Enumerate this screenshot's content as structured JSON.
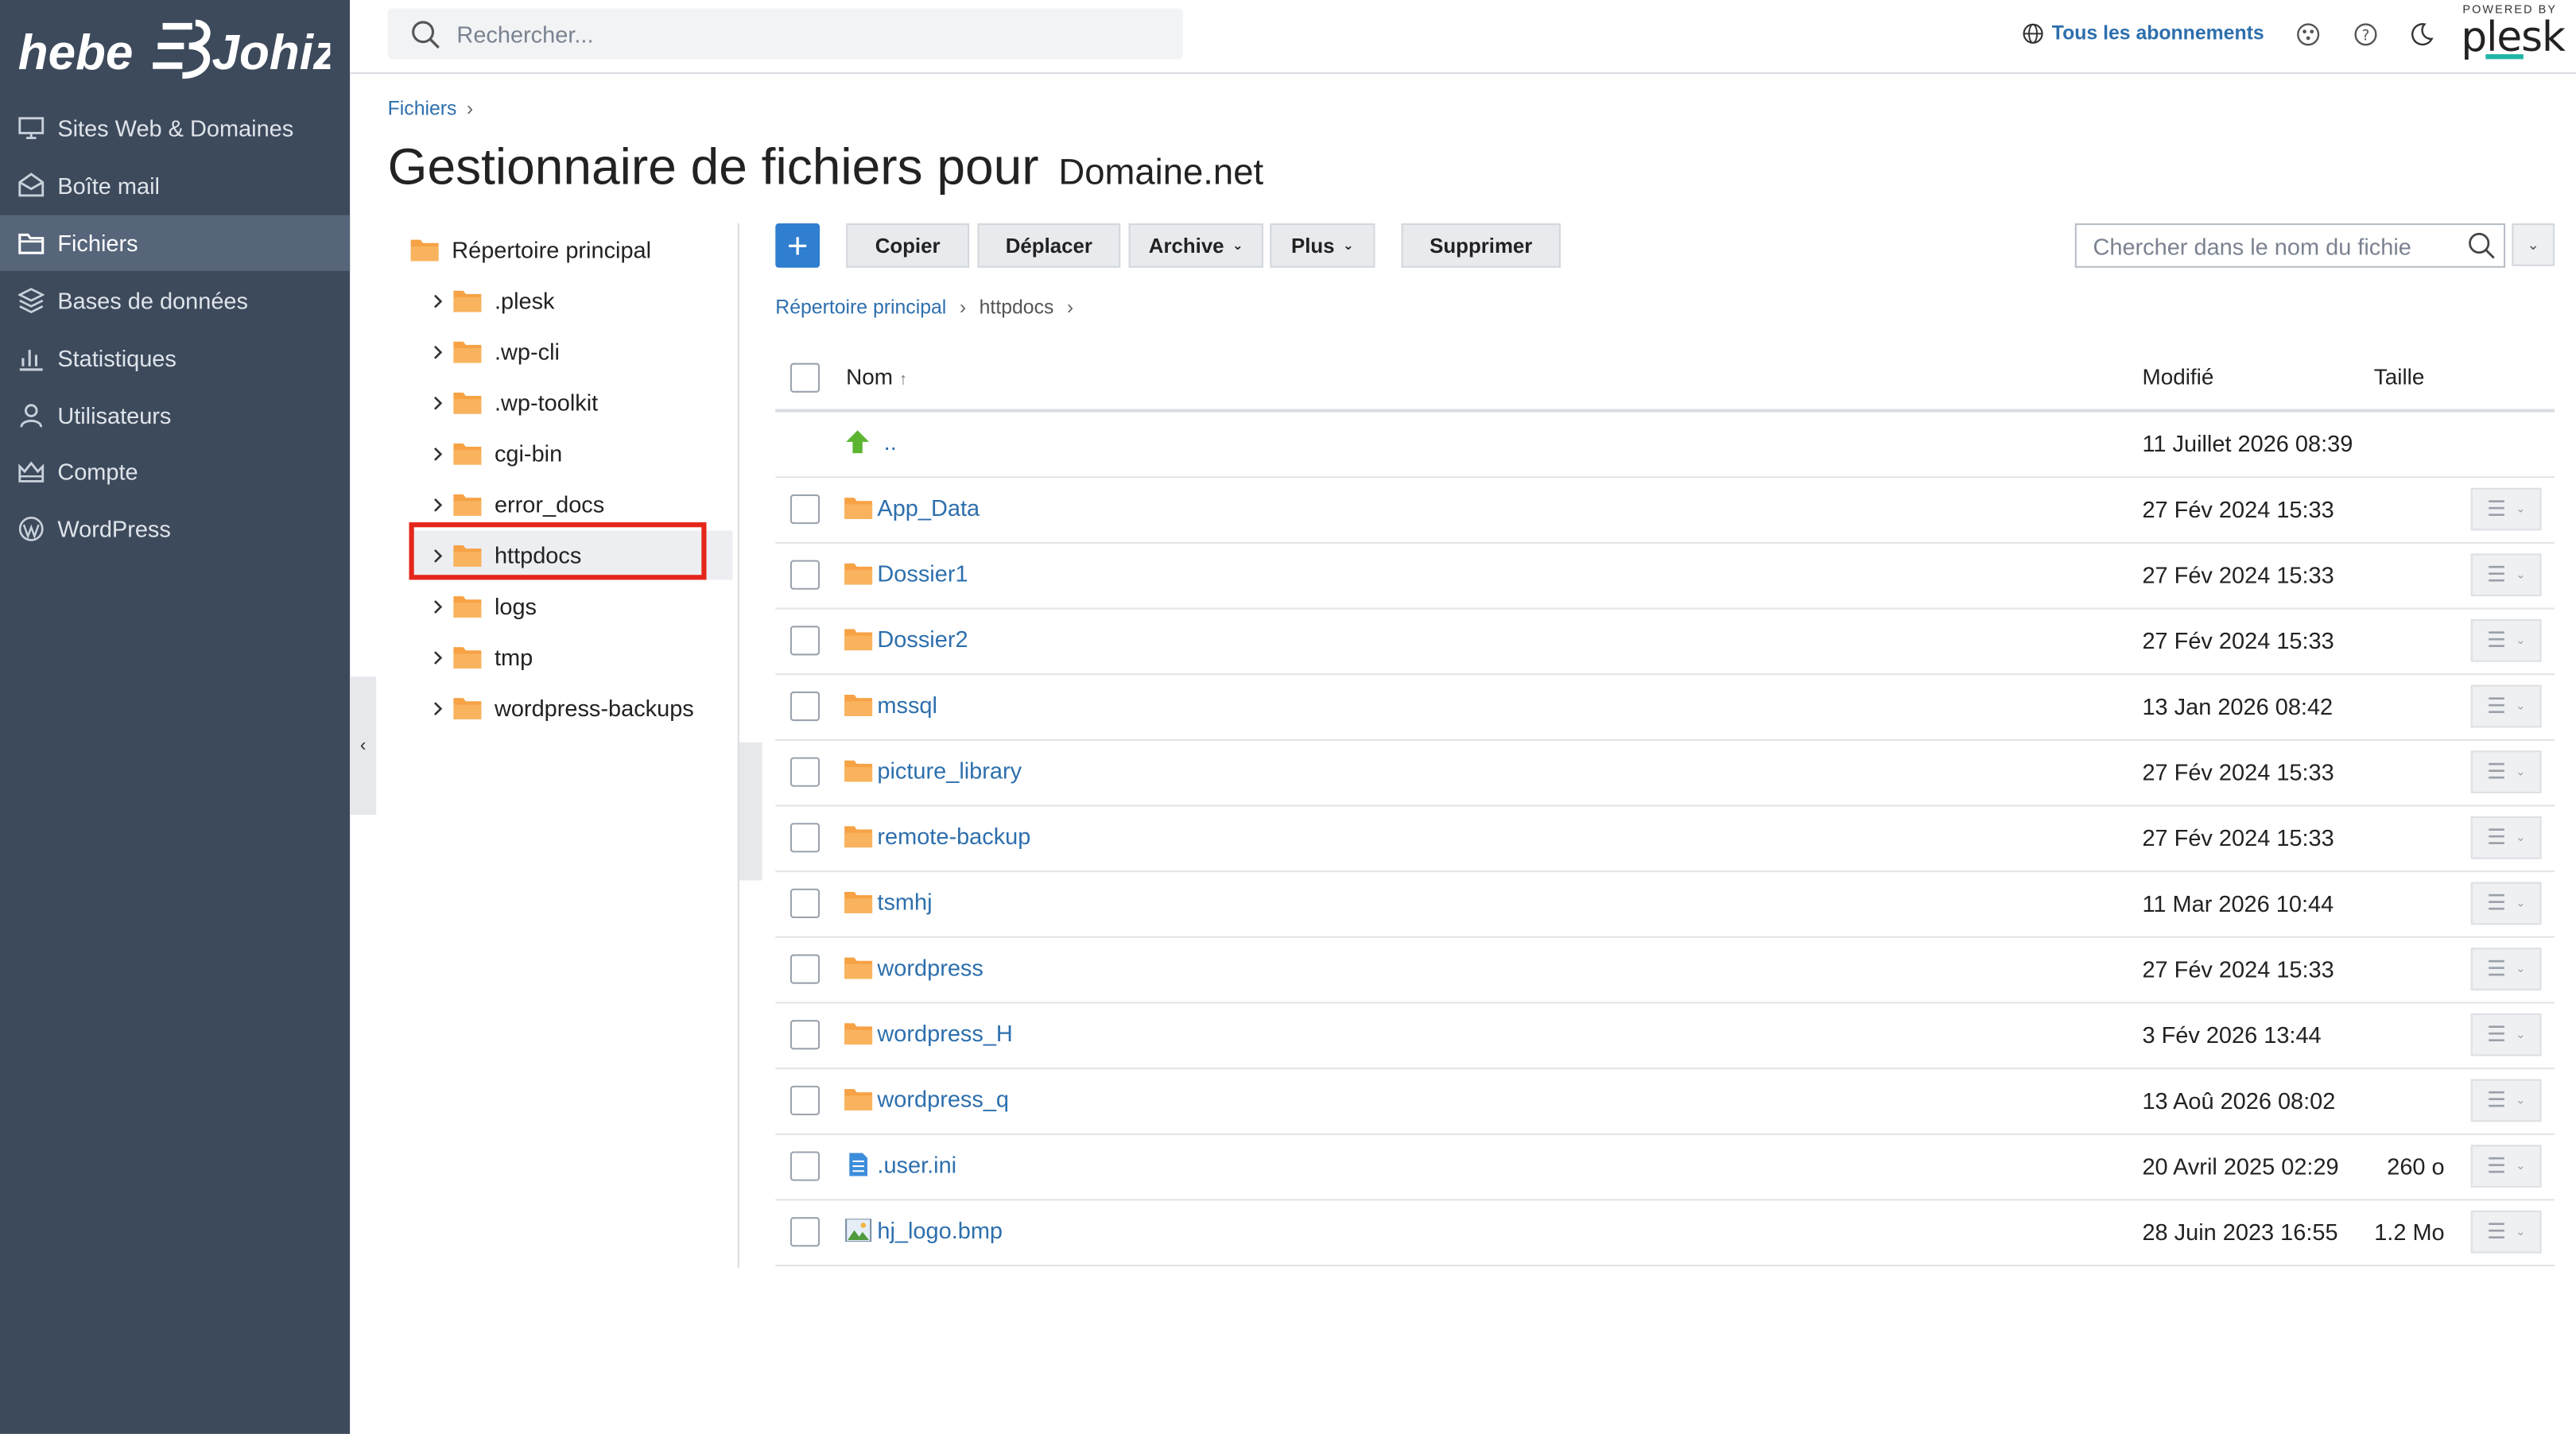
{
  "brand": {
    "logo_text": "hebe Johiz"
  },
  "sidebar": {
    "items": [
      {
        "label": "Sites Web & Domaines",
        "icon": "monitor-icon"
      },
      {
        "label": "Boîte mail",
        "icon": "mail-icon"
      },
      {
        "label": "Fichiers",
        "icon": "folder-icon",
        "active": true
      },
      {
        "label": "Bases de données",
        "icon": "database-icon"
      },
      {
        "label": "Statistiques",
        "icon": "chart-icon"
      },
      {
        "label": "Utilisateurs",
        "icon": "user-icon"
      },
      {
        "label": "Compte",
        "icon": "crown-icon"
      },
      {
        "label": "WordPress",
        "icon": "wordpress-icon"
      }
    ]
  },
  "topbar": {
    "search_placeholder": "Rechercher...",
    "subscriptions_label": "Tous les abonnements",
    "powered_by": "POWERED BY",
    "plesk": "plesk"
  },
  "breadcrumb": {
    "root": "Fichiers"
  },
  "title": {
    "main": "Gestionnaire de fichiers pour",
    "domain": "Domaine.net"
  },
  "tree": {
    "root": "Répertoire principal",
    "items": [
      ".plesk",
      ".wp-cli",
      ".wp-toolkit",
      "cgi-bin",
      "error_docs",
      "httpdocs",
      "logs",
      "tmp",
      "wordpress-backups"
    ],
    "selected": "httpdocs"
  },
  "toolbar": {
    "add": "+",
    "copy": "Copier",
    "move": "Déplacer",
    "archive": "Archive",
    "more": "Plus",
    "delete": "Supprimer",
    "search_placeholder": "Chercher dans le nom du fichie"
  },
  "path": {
    "root": "Répertoire principal",
    "current": "httpdocs"
  },
  "table": {
    "headers": {
      "name": "Nom",
      "sort_arrow": "↑",
      "modified": "Modifié",
      "size": "Taille"
    },
    "parent": {
      "name": "..",
      "modified": "11 Juillet 2026 08:39"
    },
    "rows": [
      {
        "name": "App_Data",
        "type": "folder",
        "modified": "27 Fév 2024 15:33",
        "size": ""
      },
      {
        "name": "Dossier1",
        "type": "folder",
        "modified": "27 Fév 2024 15:33",
        "size": ""
      },
      {
        "name": "Dossier2",
        "type": "folder",
        "modified": "27 Fév 2024 15:33",
        "size": ""
      },
      {
        "name": "mssql",
        "type": "folder",
        "modified": "13 Jan 2026 08:42",
        "size": ""
      },
      {
        "name": "picture_library",
        "type": "folder",
        "modified": "27 Fév 2024 15:33",
        "size": ""
      },
      {
        "name": "remote-backup",
        "type": "folder",
        "modified": "27 Fév 2024 15:33",
        "size": ""
      },
      {
        "name": "tsmhj",
        "type": "folder",
        "modified": "11 Mar 2026 10:44",
        "size": ""
      },
      {
        "name": "wordpress",
        "type": "folder",
        "modified": "27 Fév 2024 15:33",
        "size": ""
      },
      {
        "name": "wordpress_H",
        "type": "folder",
        "modified": "3 Fév 2026 13:44",
        "size": ""
      },
      {
        "name": "wordpress_q",
        "type": "folder",
        "modified": "13 Aoû 2026 08:02",
        "size": ""
      },
      {
        "name": ".user.ini",
        "type": "text-file",
        "modified": "20 Avril 2025 02:29",
        "size": "260 o"
      },
      {
        "name": "hj_logo.bmp",
        "type": "image-file",
        "modified": "28 Juin 2023 16:55",
        "size": "1.2 Mo"
      }
    ]
  },
  "colors": {
    "sidebar_bg": "#3d4a5c",
    "sidebar_active": "#56657a",
    "link": "#2d6fad",
    "primary_button": "#2f7ecf",
    "folder": "#f6a245",
    "highlight": "#e5261a"
  }
}
